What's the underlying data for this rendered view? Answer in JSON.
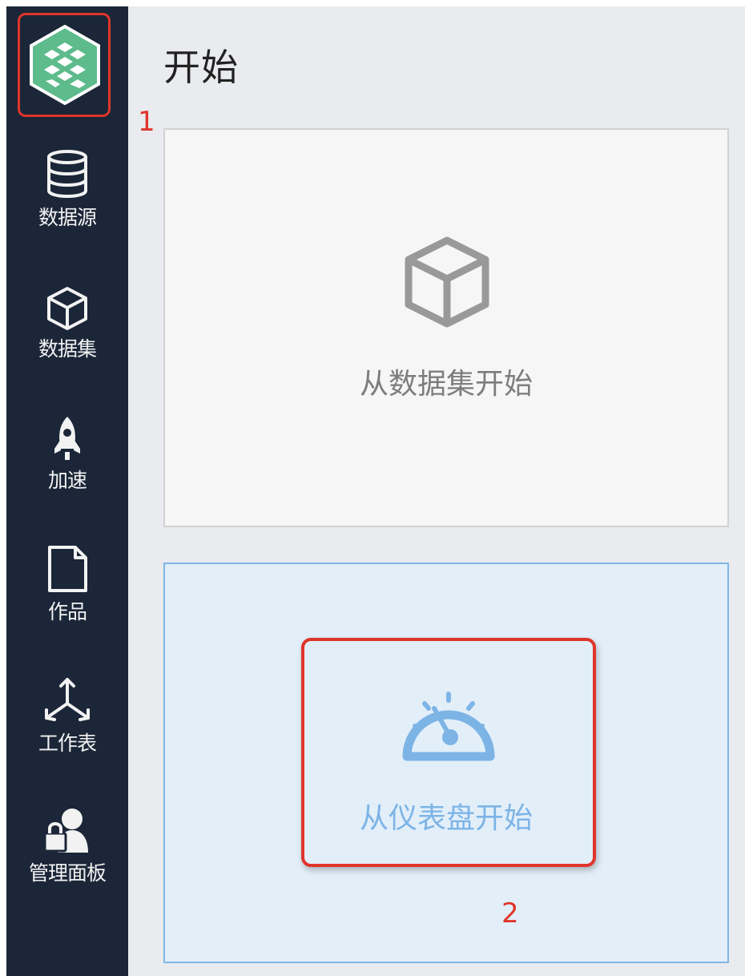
{
  "sidebar": {
    "logo_icon": "app-logo-hexagon-icon",
    "items": [
      {
        "label": "数据源",
        "icon": "database-icon"
      },
      {
        "label": "数据集",
        "icon": "cube-icon"
      },
      {
        "label": "加速",
        "icon": "rocket-icon"
      },
      {
        "label": "作品",
        "icon": "document-icon"
      },
      {
        "label": "工作表",
        "icon": "axis-icon"
      },
      {
        "label": "管理面板",
        "icon": "user-lock-icon"
      }
    ]
  },
  "main": {
    "title": "开始",
    "cards": [
      {
        "label": "从数据集开始",
        "icon": "cube-icon"
      },
      {
        "label": "从仪表盘开始",
        "icon": "gauge-icon"
      }
    ]
  },
  "annotations": {
    "first": "1",
    "second": "2"
  },
  "colors": {
    "sidebar_bg": "#1b2638",
    "logo_green": "#5dbb8c",
    "highlight_red": "#e0352b",
    "accent_blue": "#7db4e6"
  }
}
